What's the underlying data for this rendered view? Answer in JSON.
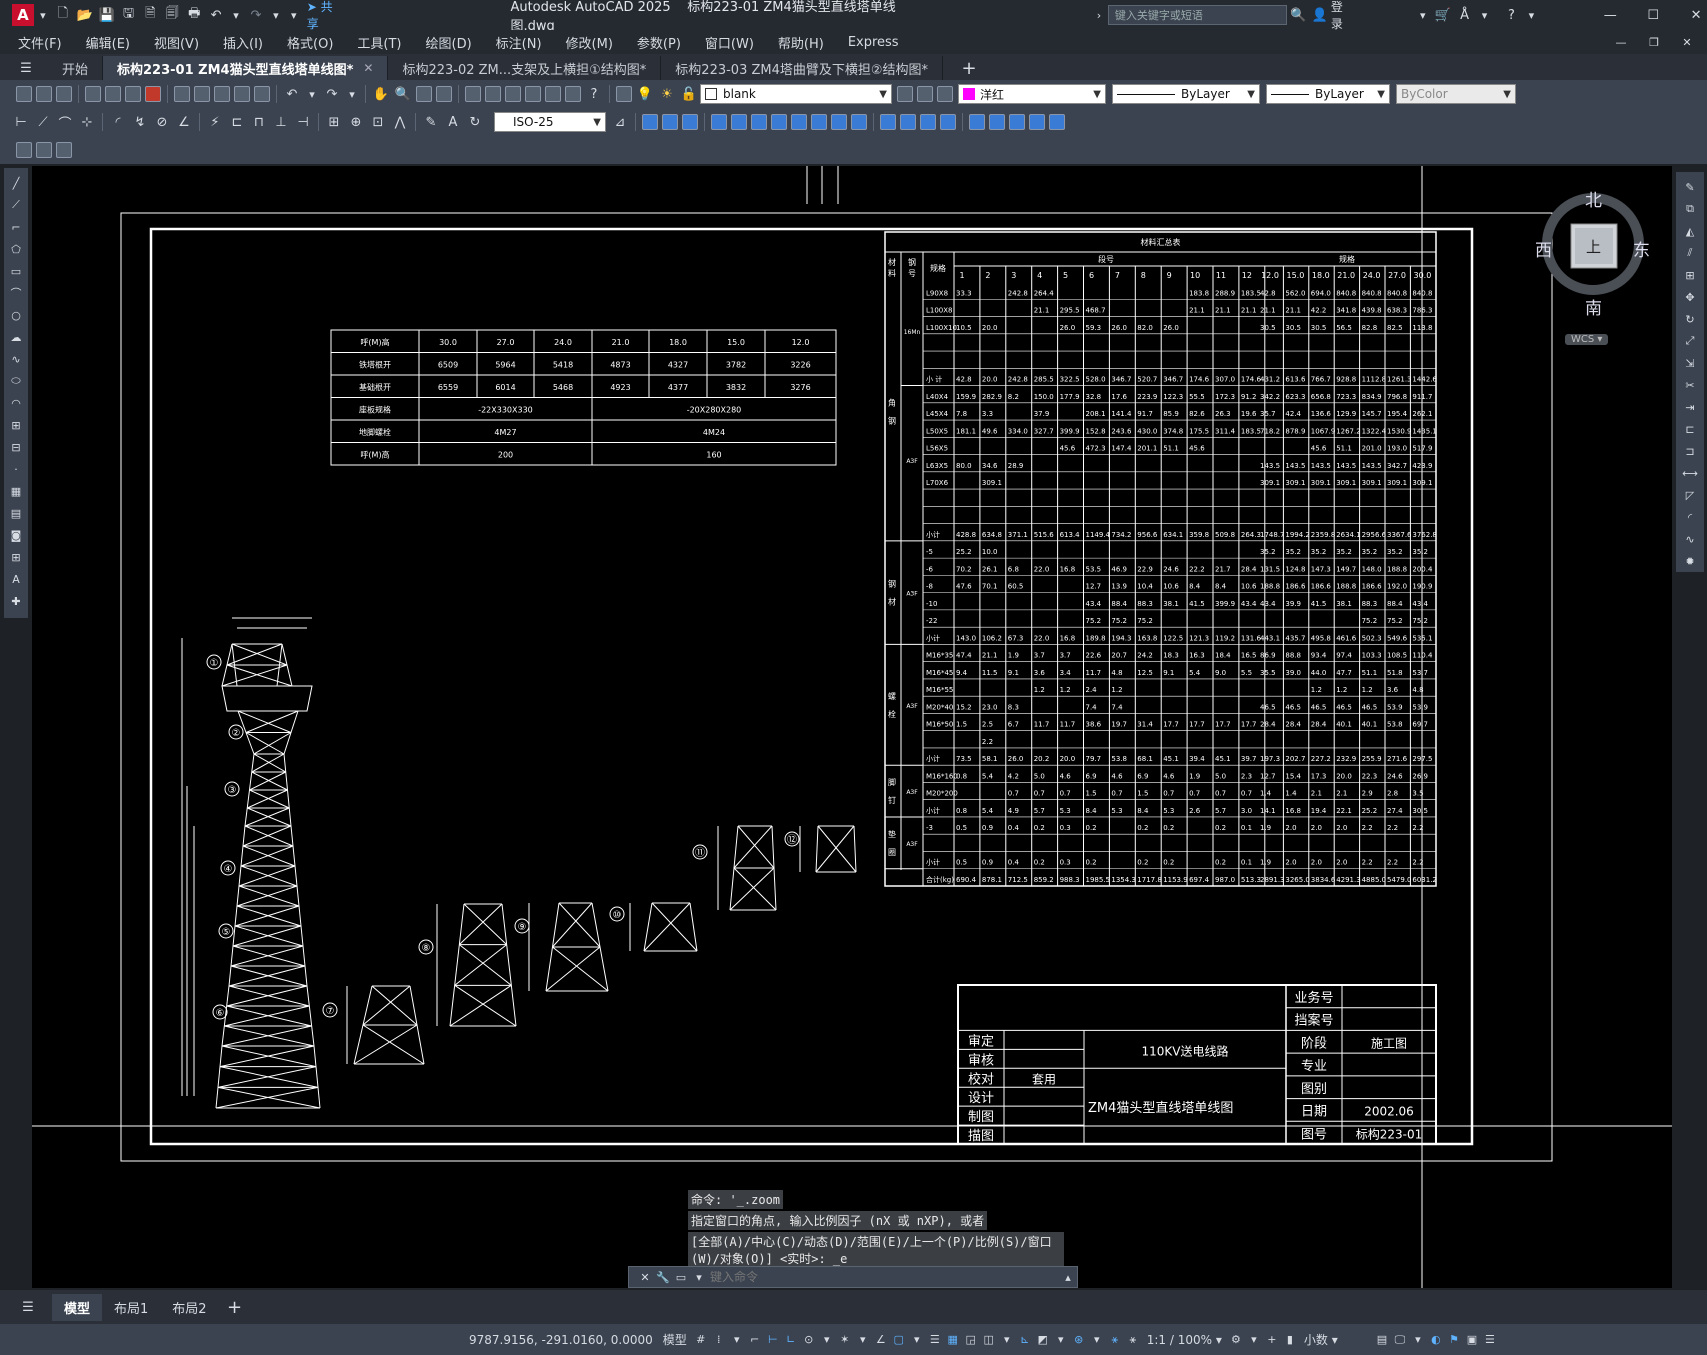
{
  "app": {
    "logo": "A",
    "title": "Autodesk AutoCAD 2025",
    "filename": "标构223-01 ZM4猫头型直线塔单线图.dwg",
    "share": "共享",
    "search_placeholder": "键入关键字或短语",
    "login": "登录"
  },
  "menu": [
    "文件(F)",
    "编辑(E)",
    "视图(V)",
    "插入(I)",
    "格式(O)",
    "工具(T)",
    "绘图(D)",
    "标注(N)",
    "修改(M)",
    "参数(P)",
    "窗口(W)",
    "帮助(H)",
    "Express"
  ],
  "tabs": {
    "start": "开始",
    "items": [
      "标构223-01 ZM4猫头型直线塔单线图*",
      "标构223-02 ZM...支架及上横担①结构图*",
      "标构223-03 ZM4塔曲臂及下横担②结构图*"
    ]
  },
  "properties": {
    "layer": "blank",
    "color": "洋红",
    "color_hex": "#ff00ff",
    "linetype": "ByLayer",
    "lineweight": "ByLayer",
    "plotstyle": "ByColor",
    "dimstyle": "ISO-25"
  },
  "viewcube": {
    "north": "北",
    "south": "南",
    "east": "东",
    "west": "西",
    "top": "上",
    "wcs": "WCS"
  },
  "params_table": {
    "rows": [
      [
        "呼(M)高",
        "30.0",
        "27.0",
        "24.0",
        "21.0",
        "18.0",
        "15.0",
        "12.0"
      ],
      [
        "铁塔根开",
        "6509",
        "5964",
        "5418",
        "4873",
        "4327",
        "3782",
        "3226"
      ],
      [
        "基础根开",
        "6559",
        "6014",
        "5468",
        "4923",
        "4377",
        "3832",
        "3276"
      ]
    ],
    "merged": [
      [
        "座板规格",
        "-22X330X330",
        "-20X280X280"
      ],
      [
        "地脚螺栓",
        "4M27",
        "4M24"
      ],
      [
        "呼(M)高",
        "200",
        "160"
      ]
    ]
  },
  "materials": {
    "title": "材料汇总表",
    "hdr_material": "材料",
    "hdr_grade": "钢号",
    "hdr_spec": "规格",
    "hdr_segment": "段号",
    "hdr_height": "规格",
    "segments": [
      "1",
      "2",
      "3",
      "4",
      "5",
      "6",
      "7",
      "8",
      "9",
      "10",
      "11",
      "12"
    ],
    "heights": [
      "12.0",
      "15.0",
      "18.0",
      "21.0",
      "24.0",
      "27.0",
      "30.0"
    ],
    "groups": [
      {
        "name": "角钢",
        "grade1": "16Mn",
        "grade2": "A3F"
      },
      {
        "name": "钢材",
        "grade": "A3F"
      },
      {
        "name": "螺栓",
        "grade": "A3F"
      },
      {
        "name": "脚钉",
        "grade": "A3F"
      },
      {
        "name": "垫圈",
        "grade": "A3F"
      }
    ],
    "rows": [
      [
        "L90X8",
        "33.3",
        "",
        "242.8",
        "264.4",
        "",
        "",
        "",
        "",
        "",
        "183.8",
        "288.9",
        "183.5",
        "",
        "42.8",
        "562.0",
        "694.0",
        "840.8",
        "840.8",
        "840.8",
        "840.8"
      ],
      [
        "L100X8",
        "",
        "",
        "",
        "21.1",
        "295.5",
        "468.7",
        "",
        "",
        "",
        "21.1",
        "21.1",
        "21.1",
        "",
        "21.1",
        "21.1",
        "42.2",
        "341.8",
        "439.8",
        "638.3",
        "786.3"
      ],
      [
        "L100X10",
        "10.5",
        "20.0",
        "",
        "",
        "26.0",
        "59.3",
        "26.0",
        "82.0",
        "26.0",
        "",
        "",
        "",
        "",
        "30.5",
        "30.5",
        "30.5",
        "56.5",
        "82.8",
        "82.5",
        "113.8"
      ],
      [
        "",
        "",
        "",
        "",
        "",
        "",
        "",
        "",
        "",
        "",
        "",
        "",
        "",
        "",
        "",
        "",
        "",
        "",
        "",
        "",
        ""
      ],
      [
        "",
        "",
        "",
        "",
        "",
        "",
        "",
        "",
        "",
        "",
        "",
        "",
        "",
        "",
        "",
        "",
        "",
        "",
        "",
        "",
        ""
      ],
      [
        "小 计",
        "42.8",
        "20.0",
        "242.8",
        "285.5",
        "322.5",
        "528.0",
        "346.7",
        "520.7",
        "346.7",
        "174.6",
        "307.0",
        "174.6",
        "",
        "431.2",
        "613.6",
        "766.7",
        "928.8",
        "1112.8",
        "1261.3",
        "1442.6"
      ],
      [
        "L40X4",
        "159.9",
        "282.9",
        "8.2",
        "150.0",
        "177.9",
        "32.8",
        "17.6",
        "223.9",
        "122.3",
        "55.5",
        "172.3",
        "91.2",
        "",
        "342.2",
        "623.3",
        "656.8",
        "723.3",
        "834.9",
        "796.8",
        "911.7"
      ],
      [
        "L45X4",
        "7.8",
        "3.3",
        "",
        "37.9",
        "",
        "208.1",
        "141.4",
        "91.7",
        "85.9",
        "82.6",
        "26.3",
        "19.6",
        "",
        "35.7",
        "42.4",
        "136.6",
        "129.9",
        "145.7",
        "195.4",
        "262.1"
      ],
      [
        "L50X5",
        "181.1",
        "49.6",
        "334.0",
        "327.7",
        "399.9",
        "152.8",
        "243.6",
        "430.0",
        "374.8",
        "175.5",
        "311.4",
        "183.5",
        "",
        "718.2",
        "878.9",
        "1067.9",
        "1267.2",
        "1322.4",
        "1530.9",
        "1435.1"
      ],
      [
        "L56X5",
        "",
        "",
        "",
        "",
        "45.6",
        "472.3",
        "147.4",
        "201.1",
        "51.1",
        "45.6",
        "",
        "",
        "",
        "",
        "",
        "45.6",
        "51.1",
        "201.0",
        "193.0",
        "517.9"
      ],
      [
        "L63X5",
        "80.0",
        "34.6",
        "28.9",
        "",
        "",
        "",
        "",
        "",
        "",
        "",
        "",
        "",
        "",
        "143.5",
        "143.5",
        "143.5",
        "143.5",
        "143.5",
        "342.7",
        "423.9"
      ],
      [
        "L70X6",
        "",
        "309.1",
        "",
        "",
        "",
        "",
        "",
        "",
        "",
        "",
        "",
        "",
        "",
        "309.1",
        "309.1",
        "309.1",
        "309.1",
        "309.1",
        "309.1",
        "309.1"
      ],
      [
        "",
        "",
        "",
        "",
        "",
        "",
        "",
        "",
        "",
        "",
        "",
        "",
        "",
        "",
        "",
        "",
        "",
        "",
        "",
        "",
        ""
      ],
      [
        "",
        "",
        "",
        "",
        "",
        "",
        "",
        "",
        "",
        "",
        "",
        "",
        "",
        "",
        "",
        "",
        "",
        "",
        "",
        "",
        ""
      ],
      [
        "小计",
        "428.8",
        "634.8",
        "371.1",
        "515.6",
        "613.4",
        "1149.4",
        "734.2",
        "956.6",
        "634.1",
        "359.8",
        "509.8",
        "264.3",
        "",
        "1748.7",
        "1994.2",
        "2359.8",
        "2634.1",
        "2956.6",
        "3367.6",
        "3762.8"
      ],
      [
        "-5",
        "25.2",
        "10.0",
        "",
        "",
        "",
        "",
        "",
        "",
        "",
        "",
        "",
        "",
        "",
        "35.2",
        "35.2",
        "35.2",
        "35.2",
        "35.2",
        "35.2",
        "35.2"
      ],
      [
        "-6",
        "70.2",
        "26.1",
        "6.8",
        "22.0",
        "16.8",
        "53.5",
        "46.9",
        "22.9",
        "24.6",
        "22.2",
        "21.7",
        "28.4",
        "",
        "131.5",
        "124.8",
        "147.3",
        "149.7",
        "148.0",
        "188.8",
        "200.4"
      ],
      [
        "-8",
        "47.6",
        "70.1",
        "60.5",
        "",
        "",
        "12.7",
        "13.9",
        "10.4",
        "10.6",
        "8.4",
        "8.4",
        "10.6",
        "",
        "188.8",
        "186.6",
        "186.6",
        "188.8",
        "186.6",
        "192.0",
        "190.9"
      ],
      [
        "-10",
        "",
        "",
        "",
        "",
        "",
        "43.4",
        "88.4",
        "88.3",
        "38.1",
        "41.5",
        "399.9",
        "43.4",
        "",
        "43.4",
        "39.9",
        "41.5",
        "38.1",
        "88.3",
        "88.4",
        "43.4"
      ],
      [
        "-22",
        "",
        "",
        "",
        "",
        "",
        "75.2",
        "75.2",
        "75.2",
        "",
        "",
        "",
        "",
        "",
        "",
        "",
        "",
        "",
        "75.2",
        "75.2",
        "75.2"
      ],
      [
        "小计",
        "143.0",
        "106.2",
        "67.3",
        "22.0",
        "16.8",
        "189.8",
        "194.3",
        "163.8",
        "122.5",
        "121.3",
        "119.2",
        "131.6",
        "",
        "443.1",
        "435.7",
        "495.8",
        "461.6",
        "502.3",
        "549.6",
        "535.1"
      ],
      [
        "M16*35",
        "47.4",
        "21.1",
        "1.9",
        "3.7",
        "3.7",
        "22.6",
        "20.7",
        "24.2",
        "18.3",
        "16.3",
        "18.4",
        "16.5",
        "",
        "86.9",
        "88.8",
        "93.4",
        "97.4",
        "103.3",
        "108.5",
        "110.4"
      ],
      [
        "M16*45",
        "9.4",
        "11.5",
        "9.1",
        "3.6",
        "3.4",
        "11.7",
        "4.8",
        "12.5",
        "9.1",
        "5.4",
        "9.0",
        "5.5",
        "",
        "35.5",
        "39.0",
        "44.0",
        "47.7",
        "51.1",
        "51.8",
        "53.7"
      ],
      [
        "M16*55",
        "",
        "",
        "",
        "1.2",
        "1.2",
        "2.4",
        "1.2",
        "",
        "",
        "",
        "",
        "",
        "",
        "",
        "",
        "1.2",
        "1.2",
        "1.2",
        "3.6",
        "4.8"
      ],
      [
        "M20*40",
        "15.2",
        "23.0",
        "8.3",
        "",
        "",
        "7.4",
        "7.4",
        "",
        "",
        "",
        "",
        "",
        "",
        "46.5",
        "46.5",
        "46.5",
        "46.5",
        "46.5",
        "53.9",
        "53.9"
      ],
      [
        "M16*50",
        "1.5",
        "2.5",
        "6.7",
        "11.7",
        "11.7",
        "38.6",
        "19.7",
        "31.4",
        "17.7",
        "17.7",
        "17.7",
        "17.7",
        "",
        "28.4",
        "28.4",
        "28.4",
        "40.1",
        "40.1",
        "53.8",
        "69.7"
      ],
      [
        "",
        "",
        "2.2",
        "",
        "",
        "",
        "",
        "",
        "",
        "",
        "",
        "",
        "",
        "",
        "",
        "",
        "",
        "",
        "",
        "",
        ""
      ],
      [
        "小计",
        "73.5",
        "58.1",
        "26.0",
        "20.2",
        "20.0",
        "79.7",
        "53.8",
        "68.1",
        "45.1",
        "39.4",
        "45.1",
        "39.7",
        "",
        "197.3",
        "202.7",
        "227.2",
        "232.9",
        "255.9",
        "271.6",
        "297.5"
      ],
      [
        "M16*160",
        "0.8",
        "5.4",
        "4.2",
        "5.0",
        "4.6",
        "6.9",
        "4.6",
        "6.9",
        "4.6",
        "1.9",
        "5.0",
        "2.3",
        "",
        "12.7",
        "15.4",
        "17.3",
        "20.0",
        "22.3",
        "24.6",
        "26.9"
      ],
      [
        "M20*200",
        "",
        "",
        "0.7",
        "0.7",
        "0.7",
        "1.5",
        "0.7",
        "1.5",
        "0.7",
        "0.7",
        "0.7",
        "0.7",
        "",
        "1.4",
        "1.4",
        "2.1",
        "2.1",
        "2.9",
        "2.8",
        "3.5"
      ],
      [
        "小计",
        "0.8",
        "5.4",
        "4.9",
        "5.7",
        "5.3",
        "8.4",
        "5.3",
        "8.4",
        "5.3",
        "2.6",
        "5.7",
        "3.0",
        "",
        "14.1",
        "16.8",
        "19.4",
        "22.1",
        "25.2",
        "27.4",
        "30.5"
      ],
      [
        "-3",
        "0.5",
        "0.9",
        "0.4",
        "0.2",
        "0.3",
        "0.2",
        "",
        "0.2",
        "0.2",
        "",
        "0.2",
        "0.1",
        "",
        "1.9",
        "2.0",
        "2.0",
        "2.0",
        "2.2",
        "2.2",
        "2.2"
      ],
      [
        "",
        "",
        "",
        "",
        "",
        "",
        "",
        "",
        "",
        "",
        "",
        "",
        "",
        "",
        "",
        "",
        "",
        "",
        "",
        "",
        ""
      ],
      [
        "小计",
        "0.5",
        "0.9",
        "0.4",
        "0.2",
        "0.3",
        "0.2",
        "",
        "0.2",
        "0.2",
        "",
        "0.2",
        "0.1",
        "",
        "1.9",
        "2.0",
        "2.0",
        "2.0",
        "2.2",
        "2.2",
        "2.2"
      ],
      [
        "合计(kg)",
        "690.4",
        "878.1",
        "712.5",
        "859.2",
        "988.3",
        "1985.5",
        "1354.3",
        "1717.8",
        "1153.9",
        "697.4",
        "987.0",
        "513.3",
        "",
        "2891.3",
        "3265.0",
        "3834.6",
        "4291.3",
        "4885.0",
        "5479.0",
        "6031.2"
      ]
    ]
  },
  "tower": {
    "labels": [
      "①",
      "②",
      "③",
      "④",
      "⑤",
      "⑥",
      "⑦",
      "⑧",
      "⑨",
      "⑩",
      "⑪",
      "⑫"
    ]
  },
  "titleblock": {
    "right_labels": [
      "业务号",
      "挡案号",
      "阶段",
      "专业",
      "图别",
      "日期",
      "图号"
    ],
    "right_values": [
      "",
      "",
      "施工图",
      "",
      "",
      "2002.06",
      "标构223-01"
    ],
    "left_labels": [
      "审定",
      "审核",
      "校对",
      "设计",
      "制图",
      "描图"
    ],
    "left_values": [
      "",
      "",
      "套用",
      "",
      "",
      ""
    ],
    "project": "110KV送电线路",
    "drawing_title": "ZM4猫头型直线塔单线图"
  },
  "command": {
    "history": [
      "命令: '_.zoom",
      "指定窗口的角点, 输入比例因子 (nX 或 nXP), 或者",
      "[全部(A)/中心(C)/动态(D)/范围(E)/上一个(P)/比例(S)/窗口(W)/对象(O)] <实时>: _e"
    ],
    "placeholder": "键入命令"
  },
  "layouts": [
    "模型",
    "布局1",
    "布局2"
  ],
  "status": {
    "coords": "9787.9156, -291.0160, 0.0000",
    "space": "模型",
    "scale": "1:1 / 100%",
    "units": "小数"
  }
}
